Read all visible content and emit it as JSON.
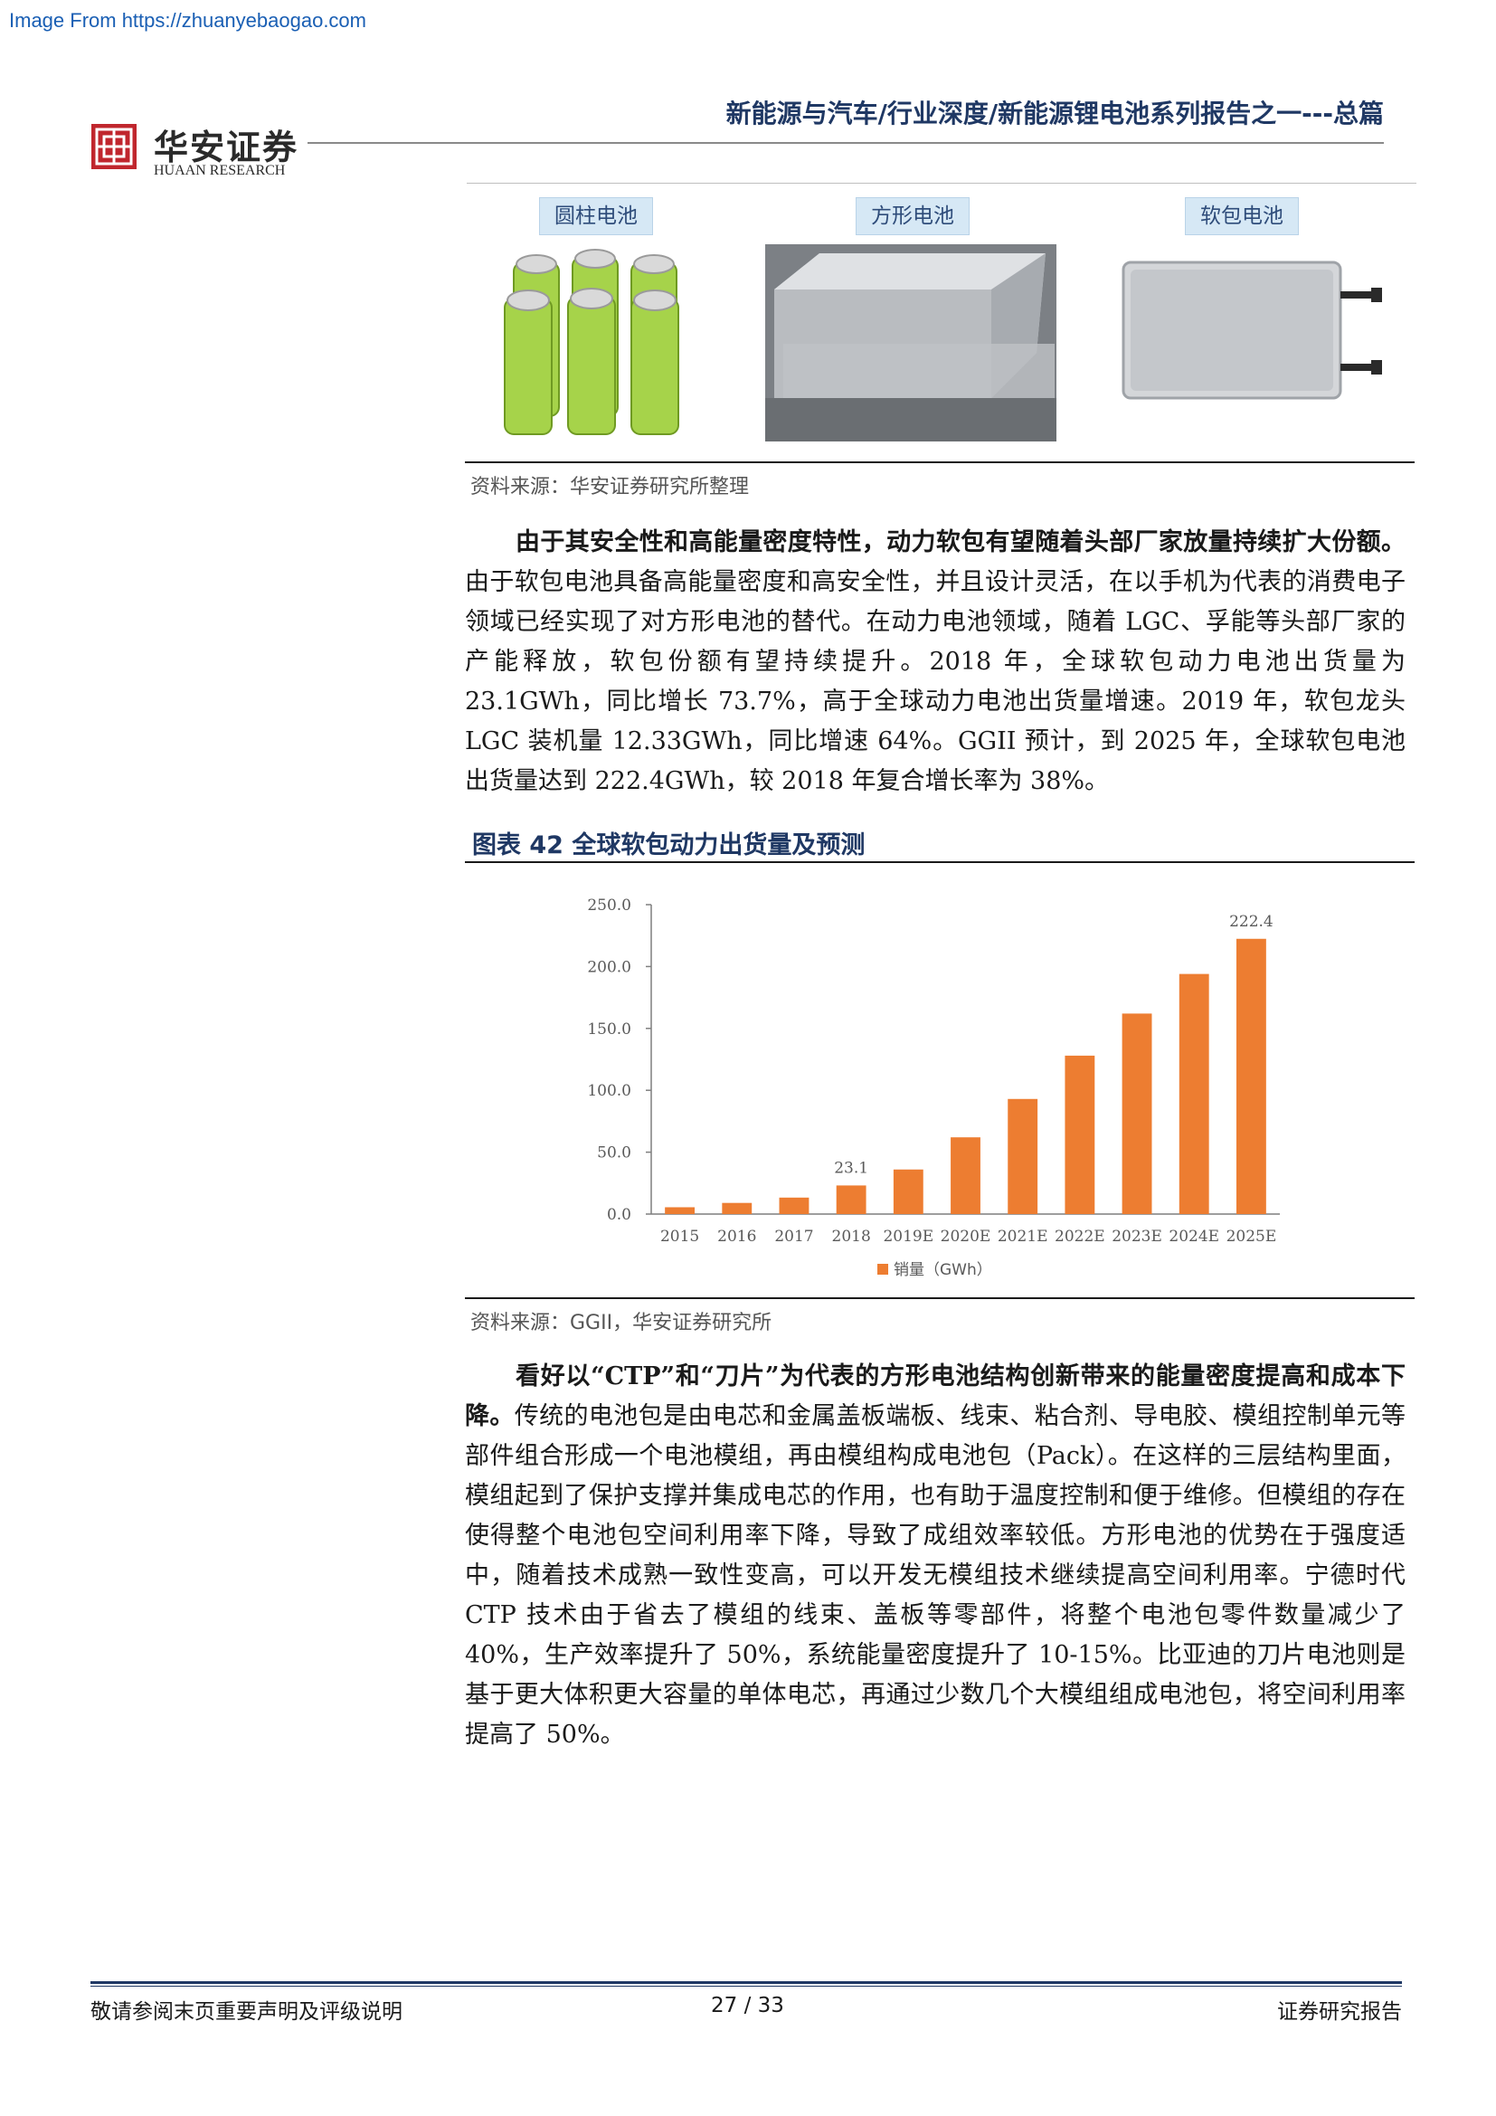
{
  "watermark": "Image From https://zhuanyebaogao.com",
  "header": {
    "logo_cn": "华安证券",
    "logo_en": "HUAAN RESEARCH",
    "title": "新能源与汽车/行业深度/新能源锂电池系列报告之一---总篇"
  },
  "figure_top": {
    "labels": [
      "圆柱电池",
      "方形电池",
      "软包电池"
    ],
    "source": "资料来源：华安证券研究所整理"
  },
  "para1": {
    "bold": "由于其安全性和高能量密度特性，动力软包有望随着头部厂家放量持续扩大份额。",
    "text": "由于软包电池具备高能量密度和高安全性，并且设计灵活，在以手机为代表的消费电子领域已经实现了对方形电池的替代。在动力电池领域，随着 LGC、孚能等头部厂家的产能释放，软包份额有望持续提升。2018 年，全球软包动力电池出货量为 23.1GWh，同比增长 73.7%，高于全球动力电池出货量增速。2019 年，软包龙头 LGC 装机量 12.33GWh，同比增速 64%。GGII 预计，到 2025 年，全球软包电池出货量达到 222.4GWh，较 2018 年复合增长率为 38%。"
  },
  "figure42": {
    "title": "图表 42 全球软包动力出货量及预测",
    "source": "资料来源：GGII，华安证券研究所"
  },
  "chart_data": {
    "type": "bar",
    "categories": [
      "2015",
      "2016",
      "2017",
      "2018",
      "2019E",
      "2020E",
      "2021E",
      "2022E",
      "2023E",
      "2024E",
      "2025E"
    ],
    "series": [
      {
        "name": "销量（GWh）",
        "values": [
          5.5,
          9.0,
          13.3,
          23.1,
          36.0,
          62.0,
          93.0,
          128.0,
          162.0,
          194.0,
          222.4
        ]
      }
    ],
    "data_labels": {
      "3": "23.1",
      "10": "222.4"
    },
    "ylim": [
      0,
      250
    ],
    "yticks": [
      "0.0",
      "50.0",
      "100.0",
      "150.0",
      "200.0",
      "250.0"
    ],
    "bar_color": "#ed7d31",
    "legend_position": "bottom",
    "grid": false
  },
  "para2": {
    "bold": "看好以“CTP”和“刀片”为代表的方形电池结构创新带来的能量密度提高和成本下降。",
    "text": "传统的电池包是由电芯和金属盖板端板、线束、粘合剂、导电胶、模组控制单元等部件组合形成一个电池模组，再由模组构成电池包（Pack）。在这样的三层结构里面，模组起到了保护支撑并集成电芯的作用，也有助于温度控制和便于维修。但模组的存在使得整个电池包空间利用率下降，导致了成组效率较低。方形电池的优势在于强度适中，随着技术成熟一致性变高，可以开发无模组技术继续提高空间利用率。宁德时代 CTP 技术由于省去了模组的线束、盖板等零部件，将整个电池包零件数量减少了 40%，生产效率提升了 50%，系统能量密度提升了 10-15%。比亚迪的刀片电池则是基于更大体积更大容量的单体电芯，再通过少数几个大模组组成电池包，将空间利用率提高了 50%。"
  },
  "footer": {
    "left": "敬请参阅末页重要声明及评级说明",
    "page": "27 / 33",
    "right": "证券研究报告"
  }
}
